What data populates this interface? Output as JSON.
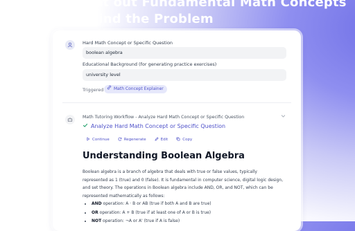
{
  "hero": {
    "title_line1": "Point out Fundamental Math Concepts",
    "title_line2": "Behind the Problem"
  },
  "form": {
    "field1_label": "Hard Math Concept or Specific Question",
    "field1_value": "boolean algebra",
    "field2_label": "Educational Background (for generating practice exercises)",
    "field2_value": "university level",
    "triggered_label": "Triggered",
    "trigger_chip": "Math Concept Explainer"
  },
  "workflow": {
    "title": "Math Tutoring Workflow - Analyze Hard Math Concept or Specific Question",
    "step_label": "Analyze Hard Math Concept or Specific Question",
    "actions": {
      "continue": "Continue",
      "regenerate": "Regenerate",
      "edit": "Edit",
      "copy": "Copy"
    }
  },
  "content": {
    "heading": "Understanding Boolean Algebra",
    "paragraph": "Boolean algebra is a branch of algebra that deals with true or false values, typically represented as 1 (true) and 0 (false). It is fundamental in computer science, digital logic design, and set theory. The operations in Boolean algebra include AND, OR, and NOT, which can be represented mathematically as follows:",
    "bullets": [
      {
        "term": "AND",
        "text": " operation: A · B or AB (true if both A and B are true)"
      },
      {
        "term": "OR",
        "text": " operation: A + B (true if at least one of A or B is true)"
      },
      {
        "term": "NOT",
        "text": " operation: ¬A or A' (true if A is false)"
      }
    ]
  },
  "colors": {
    "accent": "#4f52c9",
    "gradient": "#6f6fe6"
  },
  "icons": [
    "user-icon",
    "bot-icon",
    "link-icon",
    "check-icon",
    "chevron-down-icon",
    "play-icon",
    "regenerate-icon",
    "edit-icon",
    "copy-icon"
  ]
}
